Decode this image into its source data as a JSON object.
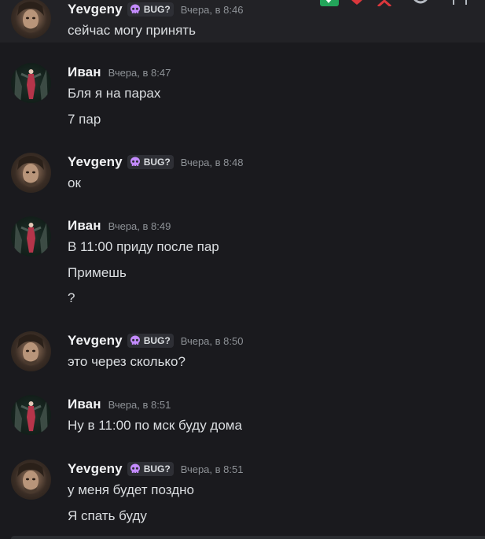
{
  "colors": {
    "background": "#1a1a1e",
    "hover_row": "#222226",
    "username": "#f2f3f5",
    "text": "#dbdee1",
    "timestamp": "#8e9297",
    "tag_bg": "#2e2f35",
    "tag_icon": "#c48bff",
    "toolbar_green": "#23a55a",
    "toolbar_red": "#da373c"
  },
  "messages": [
    {
      "author": "Yevgeny",
      "tag": "BUG?",
      "time": "Вчера, в 8:46",
      "lines": [
        "сейчас могу принять"
      ]
    },
    {
      "author": "Иван",
      "tag": "",
      "time": "Вчера, в 8:47",
      "lines": [
        "Бля я на парах",
        "7 пар"
      ]
    },
    {
      "author": "Yevgeny",
      "tag": "BUG?",
      "time": "Вчера, в 8:48",
      "lines": [
        "ок"
      ]
    },
    {
      "author": "Иван",
      "tag": "",
      "time": "Вчера, в 8:49",
      "lines": [
        "В 11:00 приду после пар",
        "Примешь",
        "?"
      ]
    },
    {
      "author": "Yevgeny",
      "tag": "BUG?",
      "time": "Вчера, в 8:50",
      "lines": [
        "это через сколько?"
      ]
    },
    {
      "author": "Иван",
      "tag": "",
      "time": "Вчера, в 8:51",
      "lines": [
        "Ну в 11:00 по мск буду дома"
      ]
    },
    {
      "author": "Yevgeny",
      "tag": "BUG?",
      "time": "Вчера, в 8:51",
      "lines": [
        "у меня будет поздно",
        "Я спать буду"
      ]
    }
  ],
  "toolbar": {
    "icons": [
      "check-reaction-icon",
      "heart-reaction-icon",
      "x-reaction-icon",
      "more-reactions-icon",
      "more-options-icon"
    ]
  }
}
